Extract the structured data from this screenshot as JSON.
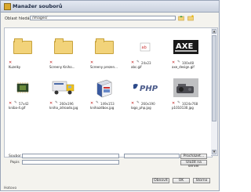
{
  "window": {
    "title": "Manažer souborů"
  },
  "toolbar": {
    "label": "Oblast hledání",
    "path": "/images/"
  },
  "items": [
    {
      "name": "Kuzelky",
      "dims": "",
      "type": "folder",
      "has_edit": false
    },
    {
      "name": "Screeny Kniho...",
      "dims": "",
      "type": "folder",
      "has_edit": false
    },
    {
      "name": "Screeny prezen...",
      "dims": "",
      "type": "folder",
      "has_edit": false
    },
    {
      "name": "abc.gif",
      "dims": "24x23",
      "type": "image-abc",
      "has_edit": true
    },
    {
      "name": "axe_design.gif",
      "dims": "100x48",
      "type": "image-axe",
      "has_edit": true
    },
    {
      "name": "kniba-4.gif",
      "dims": "57x42",
      "type": "image-chip",
      "has_edit": true
    },
    {
      "name": "kniha_zdroado.jpg",
      "dims": "260x196",
      "type": "image-truck",
      "has_edit": true
    },
    {
      "name": "knihazdbox.jpg",
      "dims": "149x153",
      "type": "image-box",
      "has_edit": true
    },
    {
      "name": "logo_php.jpg",
      "dims": "260x190",
      "type": "image-php",
      "has_edit": true
    },
    {
      "name": "p1010130.jpg",
      "dims": "1024x768",
      "type": "image-photo",
      "has_edit": true
    }
  ],
  "form": {
    "soubor_label": "Soubor",
    "popis_label": "Popis",
    "browse_label": "Procházet...",
    "upload_label": "Uložit na server"
  },
  "buttons": {
    "refresh": "Obnovit",
    "ok": "OK",
    "cancel": "Storno"
  },
  "status": "Hotovo"
}
